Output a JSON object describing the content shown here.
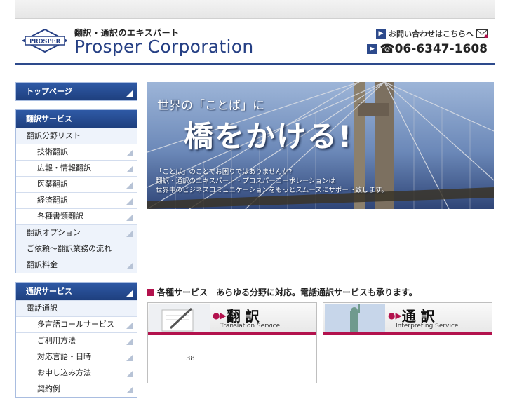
{
  "header": {
    "logo_badge": "PROSPER",
    "tagline": "翻訳・通訳のエキスパート",
    "company": "Prosper Corporation",
    "contact_label": "お問い合わせはこちらへ",
    "phone": "☎06-6347-1608"
  },
  "sidebar": {
    "translation": {
      "top_label": "トップページ",
      "head": "翻訳サービス",
      "items": [
        {
          "label": "翻訳分野リスト",
          "level": 1
        },
        {
          "label": "技術翻訳",
          "level": 2
        },
        {
          "label": "広報・情報翻訳",
          "level": 2
        },
        {
          "label": "医薬翻訳",
          "level": 2
        },
        {
          "label": "経済翻訳",
          "level": 2
        },
        {
          "label": "各種書類翻訳",
          "level": 2
        },
        {
          "label": "翻訳オプション",
          "level": 1
        },
        {
          "label": "ご依頼〜翻訳業務の流れ",
          "level": 1
        },
        {
          "label": "翻訳料金",
          "level": 1
        }
      ]
    },
    "interpreting": {
      "head": "通訳サービス",
      "items": [
        {
          "label": "電話通訳",
          "level": 1
        },
        {
          "label": "多言語コールサービス",
          "level": 2
        },
        {
          "label": "ご利用方法",
          "level": 2
        },
        {
          "label": "対応言語・日時",
          "level": 2
        },
        {
          "label": "お申し込み方法",
          "level": 2
        },
        {
          "label": "契約例",
          "level": 2
        }
      ]
    }
  },
  "banner": {
    "line1": "世界の「ことば」に",
    "line2": "橋をかける!",
    "desc1": "「ことば」のことでお困りではありませんか?",
    "desc2": "翻訳・通訳のエキスパート・プロスパーコーポレーションは",
    "desc3": "世界中のビジネスコミュニケーションをもっとスムーズにサポート致します。"
  },
  "services": {
    "heading": "各種サービス　あらゆる分野に対応。電話通訳サービスも承ります。",
    "translation": {
      "title": "翻 訳",
      "subtitle": "Translation Service",
      "number": "38"
    },
    "interpreting": {
      "title": "通 訳",
      "subtitle": "Interpreting Service"
    }
  },
  "colors": {
    "brand_blue": "#253f84",
    "accent_magenta": "#b3124d"
  }
}
